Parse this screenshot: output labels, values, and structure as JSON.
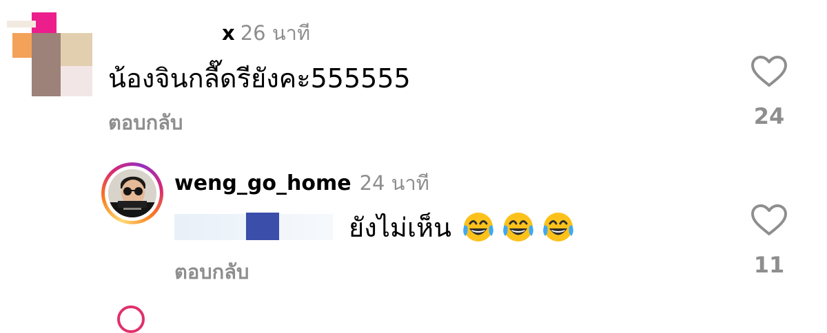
{
  "comments": [
    {
      "username_visible": "x",
      "time": "26 นาที",
      "text": "น้องจินกลื๊ดรียังคะ555555",
      "reply_label": "ตอบกลับ",
      "likes": "24"
    },
    {
      "username": "weng_go_home",
      "time": "24 นาที",
      "text": "ยังไม่เห็น",
      "emoji": [
        "face-with-tears-of-joy",
        "face-with-tears-of-joy",
        "face-with-tears-of-joy"
      ],
      "reply_label": "ตอบกลับ",
      "likes": "11"
    }
  ],
  "icons": {
    "like": "heart-outline-icon"
  },
  "colors": {
    "secondary_text": "#8e8e8e",
    "story_ring": [
      "#feda75",
      "#fa7e1e",
      "#d62976",
      "#962fbf"
    ],
    "redaction_blue": "#3b4eaa"
  }
}
